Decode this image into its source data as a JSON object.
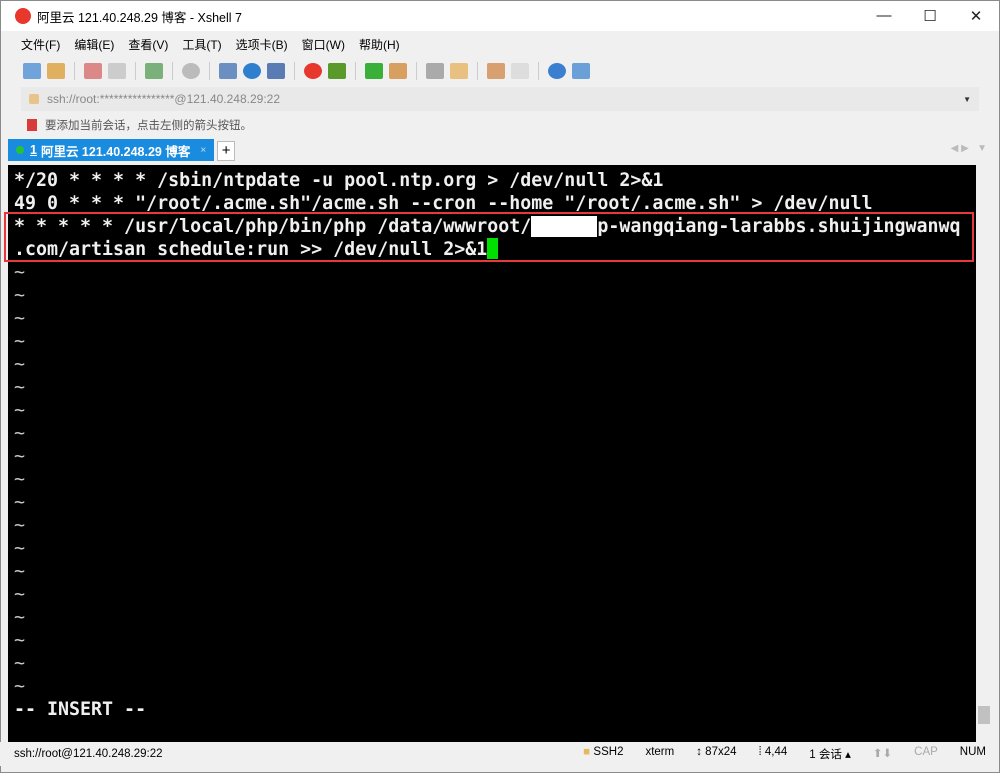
{
  "window": {
    "title": "阿里云 121.40.248.29 博客 - Xshell 7",
    "controls": [
      "—",
      "☐",
      "✕"
    ]
  },
  "menu": [
    "文件(F)",
    "编辑(E)",
    "查看(V)",
    "工具(T)",
    "选项卡(B)",
    "窗口(W)",
    "帮助(H)"
  ],
  "address": "ssh://root:****************@121.40.248.29:22",
  "hint": "要添加当前会话，点击左侧的箭头按钮。",
  "tab": {
    "number": "1",
    "label": "阿里云 121.40.248.29 博客",
    "close": "×",
    "new": "+"
  },
  "terminal": {
    "lines": [
      "*/20 * * * * /sbin/ntpdate -u pool.ntp.org > /dev/null 2>&1",
      "49 0 * * * \"/root/.acme.sh\"/acme.sh --cron --home \"/root/.acme.sh\" > /dev/null"
    ],
    "line3a": "* * * * * /usr/local/php/bin/php /data/wwwroot/",
    "line3b": "p-wangqiang-larabbs.shuijingwanwq",
    "line4": ".com/artisan schedule:run >> /dev/null 2>&1",
    "tilde": "~",
    "mode": "-- INSERT --"
  },
  "status": {
    "connection": "ssh://root@121.40.248.29:22",
    "protocol": "SSH2",
    "term": "xterm",
    "size": "87x24",
    "cursor": "4,44",
    "sessions": "1 会话",
    "cap": "CAP",
    "num": "NUM"
  }
}
